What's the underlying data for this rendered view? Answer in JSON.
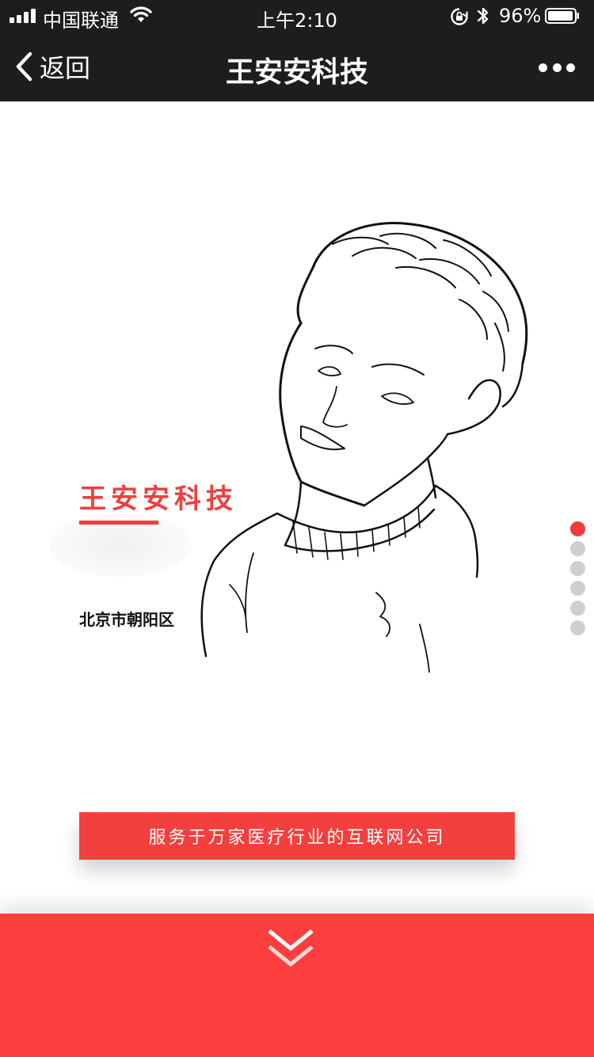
{
  "status_bar": {
    "carrier": "中国联通",
    "time": "上午2:10",
    "battery": "96%"
  },
  "nav": {
    "back_label": "返回",
    "title": "王安安科技"
  },
  "hero": {
    "company_name": "王安安科技",
    "location": "北京市朝阳区",
    "tagline": "服务于万家医疗行业的互联网公司",
    "page_indicator": {
      "total": 6,
      "active_index": 0
    }
  },
  "colors": {
    "accent": "#f43f3f",
    "nav_bg": "#1d1d20",
    "dot_inactive": "#cfcfcf"
  },
  "icons": [
    "signal-icon",
    "wifi-icon",
    "orientation-lock-icon",
    "bluetooth-icon",
    "battery-icon",
    "back-chevron-icon",
    "more-icon",
    "scroll-down-chevrons-icon"
  ]
}
